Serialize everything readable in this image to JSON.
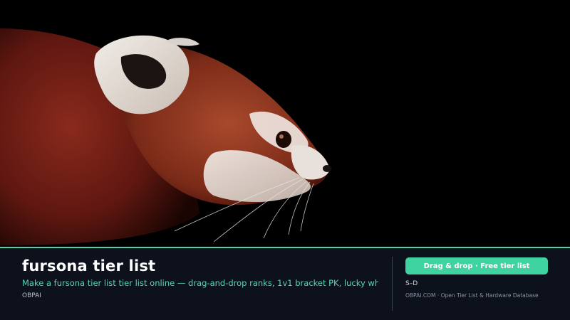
{
  "hero": {
    "image_subject": "red-panda-photo"
  },
  "card": {
    "title": "fursona tier list",
    "subtitle": "Make a fursona tier list tier list online — drag-and-drop ranks, 1v1 bracket PK, lucky whe",
    "brand": "OBPAI",
    "cta_label": "Drag & drop · Free tier list",
    "tier_range": "S–D",
    "site_note": "OBPAI.COM · Open Tier List & Hardware Database"
  },
  "colors": {
    "accent": "#4fd1b0",
    "cta_background": "#3ed3a0",
    "bar_background": "#0c111c",
    "subtitle_text": "#57d6b6"
  }
}
